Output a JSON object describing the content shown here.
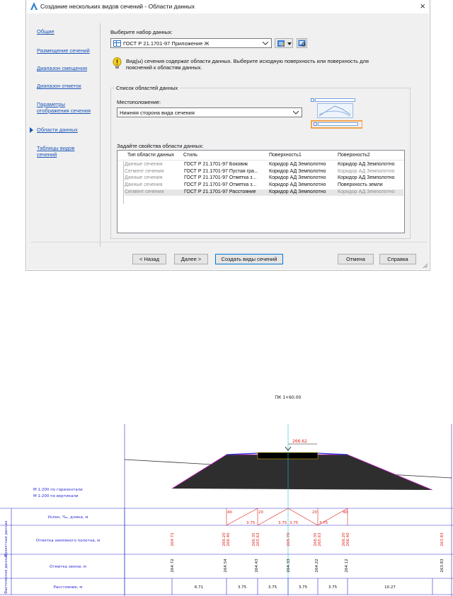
{
  "dialog": {
    "title": "Создание нескольких видов сечений - Области данных",
    "close_glyph": "×"
  },
  "nav": {
    "items": [
      {
        "label": "Общие"
      },
      {
        "label": "Размещение сечений"
      },
      {
        "label": "Диапазон смещения"
      },
      {
        "label": "Диапазон отметок"
      },
      {
        "label": "Параметры отображения сечения"
      },
      {
        "label": "Области данных"
      },
      {
        "label": "Таблицы видов сечений"
      }
    ],
    "active_index": 5
  },
  "dataset": {
    "label": "Выберите набор данных:",
    "value": "ГОСТ Р 21.1701-97 Приложение Ж"
  },
  "info_text": "Вид(ы) сечения содержат области данных. Выберите исходную поверхность или поверхность для пояснений к областям данных.",
  "areas_group": {
    "title": "Список областей данных",
    "location_label": "Местоположение:",
    "location_value": "Нижняя сторона вида сечения",
    "props_label": "Задайте свойства области данных:",
    "columns": [
      "Тип области данных",
      "Стиль",
      "Поверхность1",
      "Поверхность2"
    ],
    "rows": [
      {
        "type": "Данные сечения",
        "style": "ГОСТ Р 21.1701-97 Боковик",
        "s1": "Коридор АД Земполотно",
        "s2": "Коридор АД Земполотно",
        "s2_dim": false
      },
      {
        "type": "Сегмент сечения",
        "style": "ГОСТ Р 21.1701-97 Пустая гра...",
        "s1": "Коридор АД Земполотно",
        "s2": "Коридор АД Земполотно",
        "s2_dim": true
      },
      {
        "type": "Данные сечения",
        "style": "ГОСТ Р 21.1701-97 Отметка з...",
        "s1": "Коридор АД Земполотно",
        "s2": "Коридор АД Земполотно",
        "s2_dim": false
      },
      {
        "type": "Данные сечения",
        "style": "ГОСТ Р 21.1701-97 Отметка з...",
        "s1": "Коридор АД Земполотно",
        "s2": "Поверхность земли",
        "s2_dim": false
      },
      {
        "type": "Сегмент сечения",
        "style": "ГОСТ Р 21.1701-97 Расстояние",
        "s1": "Коридор АД Земполотно",
        "s2": "Коридор АД Земполотно",
        "s2_dim": true
      }
    ]
  },
  "buttons": {
    "back": "< Назад",
    "next": "Далее >",
    "create": "Создать виды сечений",
    "cancel": "Отмена",
    "help": "Справка"
  },
  "drawing": {
    "pk": "ПК 1+60.00",
    "elev_label": "266.62",
    "scale_h": "М 1:200 по горизонтали",
    "scale_v": "М 1:200 по вертикали",
    "group_design": "Проектные данные",
    "group_actual": "Фактические данные",
    "row_slope": "Уклон, ‰, длина, м",
    "row_design_elev": "Отметка земляного полотна, м",
    "row_ground_elev": "Отметка земли, м",
    "row_distance": "Расстояние, м",
    "slope_top": [
      "40",
      "20",
      "20",
      "40"
    ],
    "slope_bottom": [
      "3.75",
      "3.75",
      "3.75",
      "3.75"
    ],
    "design_elevs": [
      "264.72",
      "266.20",
      "266.40",
      "266.35",
      "265.63",
      "265.70",
      "266.35",
      "265.63",
      "266.20",
      "266.40",
      "263.83"
    ],
    "ground_elevs": [
      "264.72",
      "264.54",
      "264.43",
      "264.33",
      "264.22",
      "264.12",
      "263.83"
    ],
    "distances": [
      "6.71",
      "3.75",
      "3.75",
      "3.75",
      "3.75",
      "10.27"
    ],
    "colors": {
      "table_line": "#2b2bd6",
      "red": "#e0201b",
      "cyan": "#19c6d6",
      "magenta": "#d62bd6",
      "ground": "#2e2e2e"
    }
  }
}
